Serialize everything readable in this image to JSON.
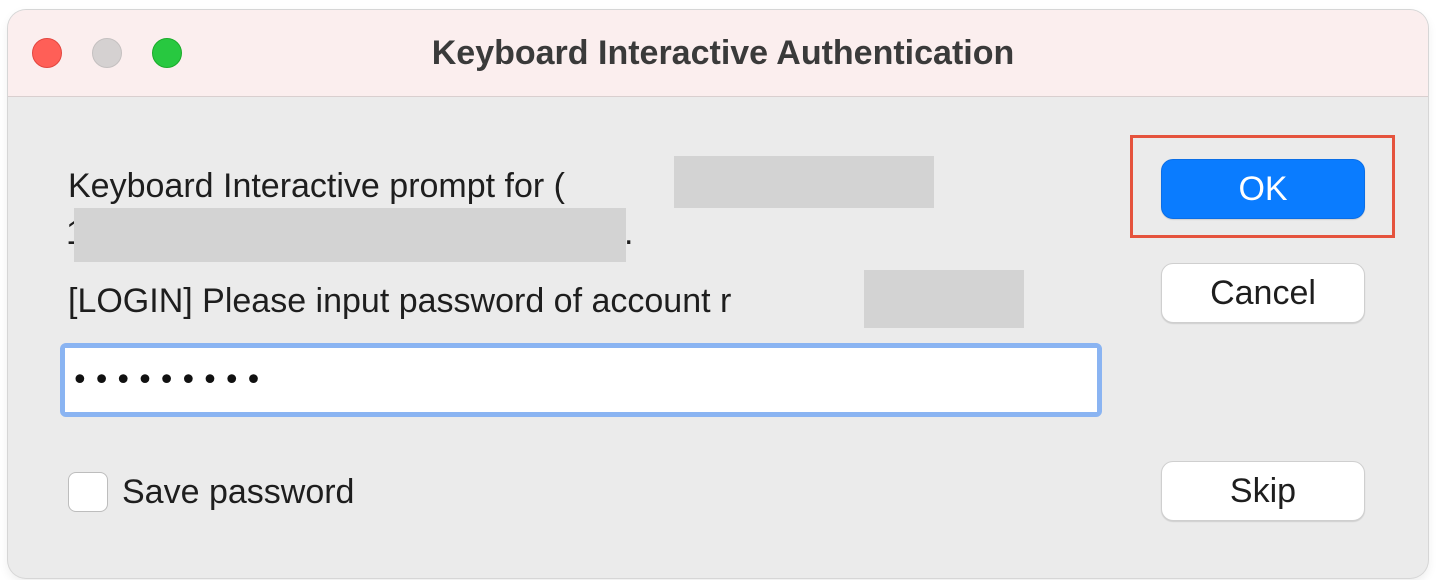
{
  "window": {
    "title": "Keyboard Interactive Authentication"
  },
  "prompt": {
    "line1": "Keyboard Interactive prompt for (",
    "line2_lead": "1",
    "line2_tail": ".",
    "login_message": "[LOGIN] Please input password of account r"
  },
  "password": {
    "masked_value": "•••••••••"
  },
  "save_password": {
    "label": "Save password",
    "checked": false
  },
  "buttons": {
    "ok": "OK",
    "cancel": "Cancel",
    "skip": "Skip"
  },
  "colors": {
    "primary": "#0a7cff",
    "focus_ring": "#8ab4f2",
    "highlight": "#e5533d",
    "close": "#ff5f57",
    "zoom": "#28c840"
  }
}
